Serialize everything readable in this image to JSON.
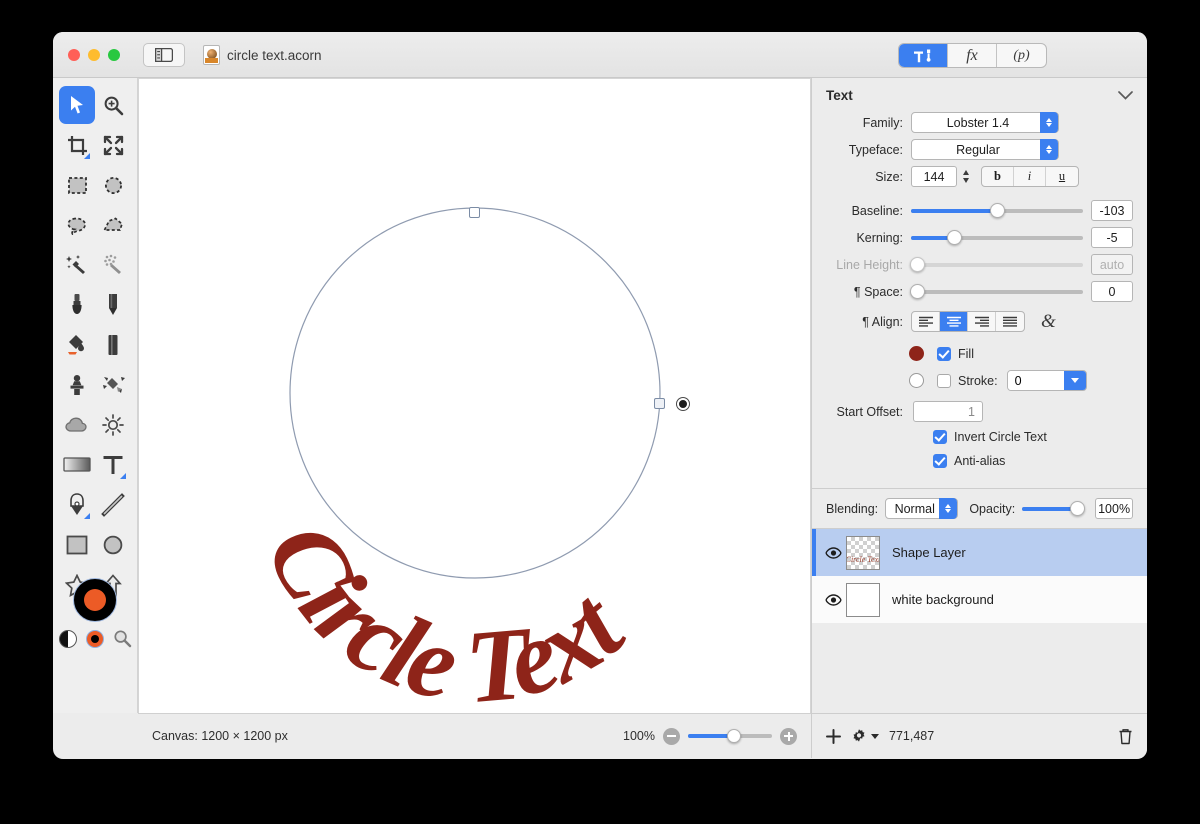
{
  "window": {
    "document_title": "circle text.acorn",
    "traffic_lights": [
      "close",
      "minimize",
      "zoom"
    ],
    "sidebar_toggle_icon": "sidebar-icon",
    "doc_icon": "acorn-document-icon"
  },
  "inspector_tabs": [
    {
      "id": "tools",
      "label": "",
      "icon": "hammer-brush-icon",
      "active": true
    },
    {
      "id": "fx",
      "label": "fx",
      "icon": "fx-icon",
      "active": false
    },
    {
      "id": "presets",
      "label": "(p)",
      "icon": "p-icon",
      "active": false
    }
  ],
  "tools": [
    {
      "name": "move-tool",
      "icon": "arrow-cursor-icon",
      "selected": true,
      "submenu": false
    },
    {
      "name": "zoom-tool",
      "icon": "magnifier-plus-icon",
      "selected": false,
      "submenu": false
    },
    {
      "name": "crop-tool",
      "icon": "crop-icon",
      "selected": false,
      "submenu": true
    },
    {
      "name": "transform-tool",
      "icon": "arrows-expand-icon",
      "selected": false,
      "submenu": false
    },
    {
      "name": "rectangular-select-tool",
      "icon": "dashed-rectangle-icon",
      "selected": false,
      "submenu": false
    },
    {
      "name": "elliptical-select-tool",
      "icon": "dashed-ellipse-icon",
      "selected": false,
      "submenu": false
    },
    {
      "name": "lasso-tool",
      "icon": "lasso-icon",
      "selected": false,
      "submenu": false
    },
    {
      "name": "polygon-lasso-tool",
      "icon": "polygon-lasso-icon",
      "selected": false,
      "submenu": false
    },
    {
      "name": "magic-wand-tool",
      "icon": "magic-wand-icon",
      "selected": false,
      "submenu": false
    },
    {
      "name": "select-similar-tool",
      "icon": "dotted-wand-icon",
      "selected": false,
      "submenu": false
    },
    {
      "name": "brush-tool",
      "icon": "brush-icon",
      "selected": false,
      "submenu": false
    },
    {
      "name": "pencil-tool",
      "icon": "pencil-icon",
      "selected": false,
      "submenu": false
    },
    {
      "name": "paint-bucket-tool",
      "icon": "paint-bucket-icon",
      "selected": false,
      "submenu": false
    },
    {
      "name": "eraser-tool",
      "icon": "eraser-icon",
      "selected": false,
      "submenu": false
    },
    {
      "name": "clone-stamp-tool",
      "icon": "clone-stamp-icon",
      "selected": false,
      "submenu": false
    },
    {
      "name": "smudge-tool",
      "icon": "smudge-icon",
      "selected": false,
      "submenu": false
    },
    {
      "name": "blur-tool",
      "icon": "cloud-icon",
      "selected": false,
      "submenu": false
    },
    {
      "name": "dodge-tool",
      "icon": "sun-icon",
      "selected": false,
      "submenu": false
    },
    {
      "name": "gradient-tool",
      "icon": "gradient-icon",
      "selected": false,
      "submenu": false
    },
    {
      "name": "text-tool",
      "icon": "text-t-icon",
      "selected": false,
      "submenu": true
    },
    {
      "name": "bezier-pen-tool",
      "icon": "pen-nib-icon",
      "selected": false,
      "submenu": true
    },
    {
      "name": "line-tool",
      "icon": "line-icon",
      "selected": false,
      "submenu": false
    },
    {
      "name": "rectangle-shape-tool",
      "icon": "rectangle-icon",
      "selected": false,
      "submenu": false
    },
    {
      "name": "ellipse-shape-tool",
      "icon": "ellipse-icon",
      "selected": false,
      "submenu": false
    },
    {
      "name": "star-shape-tool",
      "icon": "star-icon",
      "selected": false,
      "submenu": false
    },
    {
      "name": "arrow-shape-tool",
      "icon": "arrow-up-icon",
      "selected": false,
      "submenu": false
    }
  ],
  "colors": {
    "foreground": "#ec5b26",
    "background": "#000000",
    "swap_icon": "swap-colors-icon",
    "default_icon": "default-colors-icon",
    "picker_icon": "color-picker-magnifier-icon"
  },
  "canvas": {
    "artwork_text": "Circle Text",
    "text_color": "#8e2419",
    "circle_stroke": "#8f9bb0",
    "handles": [
      "top-resize-handle",
      "right-resize-handle",
      "rotation-knob"
    ]
  },
  "statusbar": {
    "canvas_info": "Canvas: 1200 × 1200 px",
    "zoom_level": "100%",
    "zoom_out_icon": "zoom-out-icon",
    "zoom_in_icon": "zoom-in-icon"
  },
  "text_panel": {
    "title": "Text",
    "collapse_icon": "chevron-down-icon",
    "family": {
      "label": "Family:",
      "value": "Lobster 1.4"
    },
    "typeface": {
      "label": "Typeface:",
      "value": "Regular"
    },
    "size": {
      "label": "Size:",
      "value": "144"
    },
    "style_buttons": [
      {
        "name": "bold-button",
        "label": "b"
      },
      {
        "name": "italic-button",
        "label": "i"
      },
      {
        "name": "underline-button",
        "label": "u"
      }
    ],
    "baseline": {
      "label": "Baseline:",
      "value": "-103",
      "fill_pct": 50
    },
    "kerning": {
      "label": "Kerning:",
      "value": "-5",
      "fill_pct": 25
    },
    "line_height": {
      "label": "Line Height:",
      "value": "auto",
      "fill_pct": 0,
      "disabled": true
    },
    "space": {
      "label": "¶ Space:",
      "value": "0",
      "fill_pct": 0
    },
    "align": {
      "label": "¶ Align:",
      "options": [
        {
          "name": "align-left-button",
          "selected": false
        },
        {
          "name": "align-center-button",
          "selected": true
        },
        {
          "name": "align-right-button",
          "selected": false
        },
        {
          "name": "align-justify-button",
          "selected": false
        }
      ],
      "glyph_button": "ampersand-glyph-icon"
    },
    "fill": {
      "label": "Fill",
      "checked": true,
      "color": "#8e2419"
    },
    "stroke": {
      "label": "Stroke:",
      "checked": false,
      "width": "0",
      "color": "#ffffff"
    },
    "start_offset": {
      "label": "Start Offset:",
      "value": "1"
    },
    "invert_circle_text": {
      "label": "Invert Circle Text",
      "checked": true
    },
    "anti_alias": {
      "label": "Anti-alias",
      "checked": true
    }
  },
  "layers_panel": {
    "blending": {
      "label": "Blending:",
      "value": "Normal"
    },
    "opacity": {
      "label": "Opacity:",
      "value": "100%",
      "fill_pct": 100
    },
    "layers": [
      {
        "name": "Shape Layer",
        "visible": true,
        "selected": true,
        "thumb": "checker"
      },
      {
        "name": "white background",
        "visible": true,
        "selected": false,
        "thumb": "white"
      }
    ],
    "toolbar": {
      "add_icon": "plus-icon",
      "settings_icon": "gear-icon",
      "coordinates": "771,487",
      "delete_icon": "trash-icon"
    }
  }
}
